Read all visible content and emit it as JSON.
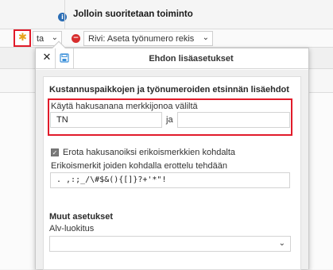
{
  "header": {
    "title": "Jolloin suoritetaan toiminto",
    "info_icon": "info-icon"
  },
  "toolbar": {
    "settings_icon": "gear-icon",
    "type_select_value": "ta",
    "remove_icon": "remove-icon",
    "rule_select_value": "Rivi: Aseta työnumero rekis",
    "accent_color": "#e11b2a"
  },
  "popup": {
    "close_label": "✕",
    "save_icon": "save-icon",
    "title": "Ehdon lisäasetukset",
    "section1": {
      "title": "Kustannuspaikkojen ja työnumeroiden etsinnän lisäehdot",
      "range_label": "Käytä hakusanana merkkijonoa väliltä",
      "from_value": "TN",
      "between_label": "ja",
      "to_value": "",
      "checkbox_label": "Erota hakusanoiksi erikoismerkkien kohdalta",
      "checkbox_checked": true,
      "special_chars_label": "Erikoismerkit joiden kohdalla erottelu tehdään",
      "special_chars_value": ". ,:;_/\\#$&(){[]}?+'*\"!"
    },
    "section2": {
      "title": "Muut asetukset",
      "vat_label": "Alv-luokitus",
      "vat_value": ""
    }
  }
}
